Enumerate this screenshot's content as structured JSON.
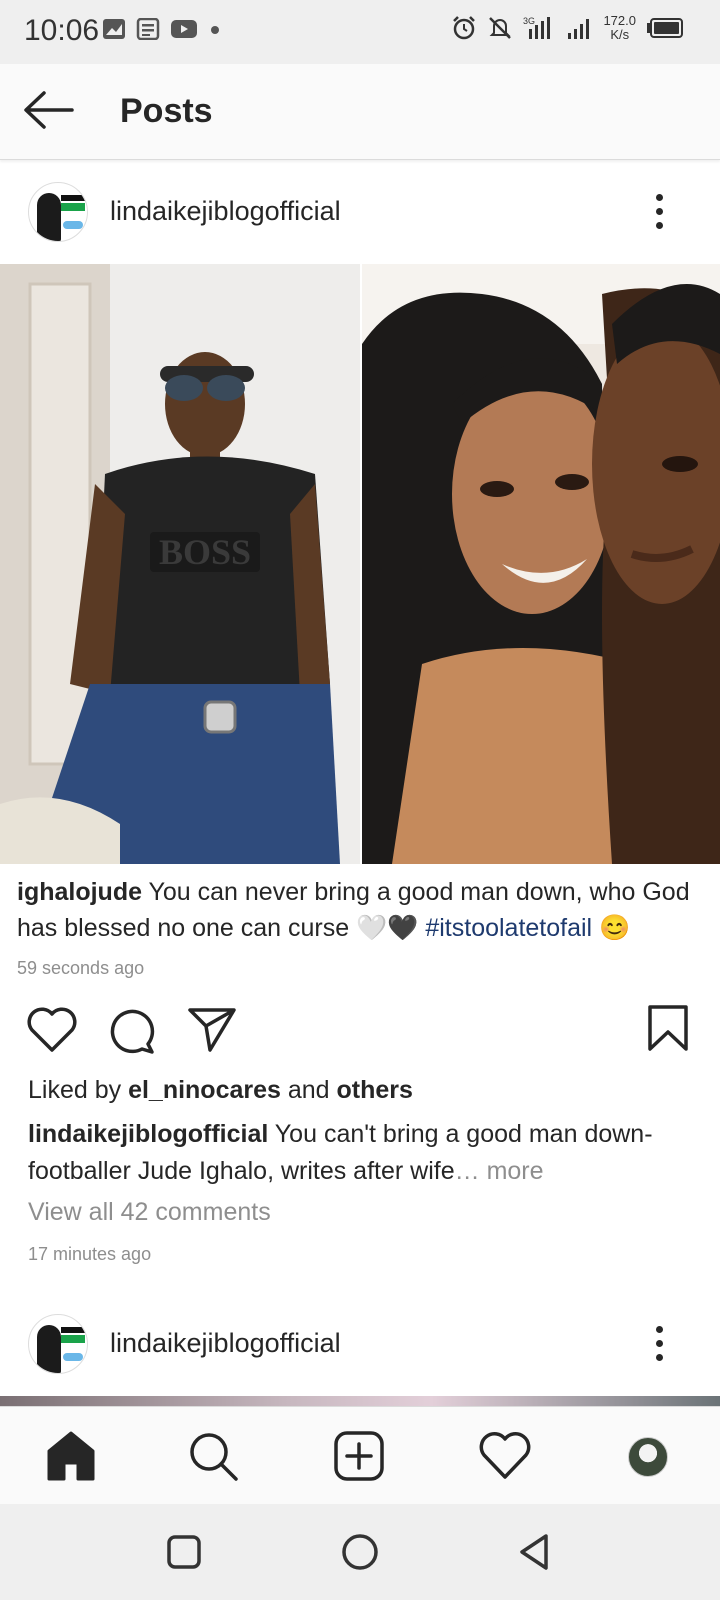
{
  "status_bar": {
    "time": "10:06",
    "speed_value": "172.0",
    "speed_unit": "K/s",
    "network": "3G"
  },
  "header": {
    "title": "Posts"
  },
  "post1": {
    "username": "lindaikejiblogofficial",
    "caption_user": "ighalojude",
    "caption_text": " You can never bring a good man down, who God has blessed no one can curse ",
    "caption_emoji": "🤍🖤",
    "caption_hashtag": "#itstoolatetofail",
    "caption_end_emoji": "😊",
    "caption_time": "59 seconds ago",
    "image_left_text": "BOSS",
    "liked_prefix": "Liked by ",
    "liked_user": "el_ninocares",
    "liked_mid": " and ",
    "liked_others": "others",
    "desc_user": "lindaikejiblogofficial",
    "desc_text": " You can't bring a good man down- footballer Jude Ighalo, writes after wife",
    "desc_more": "… more",
    "comments": "View all 42 comments",
    "time_ago": "17 minutes ago"
  },
  "post2": {
    "username": "lindaikejiblogofficial"
  },
  "icons": {
    "back": "arrow-left-icon",
    "more": "more-vertical-icon",
    "like": "heart-icon",
    "comment": "comment-icon",
    "share": "send-icon",
    "save": "bookmark-icon",
    "home": "home-icon",
    "search": "search-icon",
    "add": "add-post-icon",
    "activity": "heart-icon",
    "profile": "profile-avatar"
  },
  "colors": {
    "hashtag": "#1e3a6e",
    "muted": "#8e8e8e",
    "text": "#262626"
  }
}
